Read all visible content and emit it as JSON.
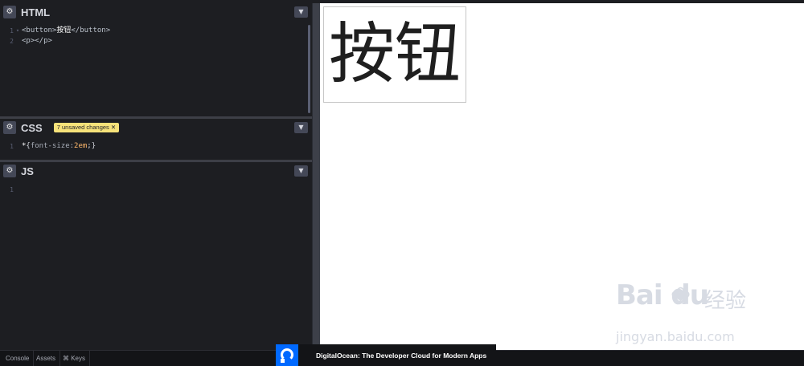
{
  "editors": {
    "html": {
      "title": "HTML",
      "lines": [
        {
          "num": "1",
          "open_tag": "<button>",
          "text": "按钮",
          "close_tag": "</button>"
        },
        {
          "num": "2",
          "code": "<p></p>"
        }
      ]
    },
    "css": {
      "title": "CSS",
      "badge": "7 unsaved changes ✕",
      "lines": [
        {
          "num": "1",
          "selector": "*",
          "open": " {",
          "prop": "font-size: ",
          "value": "2em",
          "close": ";}"
        }
      ]
    },
    "js": {
      "title": "JS",
      "lines": [
        {
          "num": "1"
        }
      ]
    }
  },
  "bottom_bar": {
    "console": "Console",
    "assets": "Assets",
    "keys": "⌘ Keys"
  },
  "ad": {
    "text": "DigitalOcean: The Developer Cloud for Modern Apps"
  },
  "preview": {
    "button_text": "按钮"
  },
  "watermark": {
    "brand": "Bai  du",
    "cn": "经验",
    "url": "jingyan.baidu.com"
  },
  "icons": {
    "settings": "gear-icon",
    "collapse": "chevron-down-icon"
  },
  "colors": {
    "editor_bg": "#1d1e22",
    "badge_bg": "#f6e27a",
    "ad_brand": "#0069ff"
  }
}
